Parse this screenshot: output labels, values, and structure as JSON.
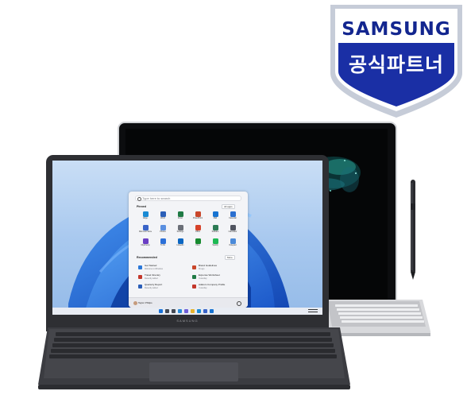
{
  "badge": {
    "brand": "SAMSUNG",
    "tag": "공식파트너",
    "colors": {
      "shield_outer": "#c2c9d6",
      "shield_inner": "#ffffff",
      "banner": "#1a2fa5",
      "brand_text": "#13268f"
    }
  },
  "laptop": {
    "bezel_brand": "SAMSUNG",
    "start_menu": {
      "search_placeholder": "Type here to search",
      "pinned_heading": "Pinned",
      "all_apps_label": "All apps",
      "pinned_apps": [
        {
          "label": "Edge",
          "color": "#1a8ad4"
        },
        {
          "label": "Word",
          "color": "#2b5fb8"
        },
        {
          "label": "Excel",
          "color": "#1f7a45"
        },
        {
          "label": "PowerPoint",
          "color": "#c9472b"
        },
        {
          "label": "Mail",
          "color": "#1773d1"
        },
        {
          "label": "Calendar",
          "color": "#2a6fd0"
        },
        {
          "label": "Microsoft Store",
          "color": "#3a64c8"
        },
        {
          "label": "Photos",
          "color": "#5a8fe0"
        },
        {
          "label": "Settings",
          "color": "#6b6f78"
        },
        {
          "label": "Office",
          "color": "#d6432b"
        },
        {
          "label": "Solitaire",
          "color": "#2c7b55"
        },
        {
          "label": "Calculator",
          "color": "#505460"
        },
        {
          "label": "Clipchamp",
          "color": "#6b3fc4"
        },
        {
          "label": "To Do",
          "color": "#2b6fd8"
        },
        {
          "label": "LinkedIn",
          "color": "#0a66c2"
        },
        {
          "label": "Xbox",
          "color": "#178a2f"
        },
        {
          "label": "Spotify",
          "color": "#1db954"
        },
        {
          "label": "Notepad",
          "color": "#4b8ad9"
        }
      ],
      "recommended_heading": "Recommended",
      "more_label": "More",
      "recommended_items": [
        {
          "title": "Get Started",
          "subtitle": "Welcome to Windows",
          "color": "#2b78d8"
        },
        {
          "title": "Travel Itinerary",
          "subtitle": "Recently added",
          "color": "#c3372b"
        },
        {
          "title": "Quarterly Report",
          "subtitle": "Recently added",
          "color": "#2b5fb8"
        },
        {
          "title": "Brand Guidelines",
          "subtitle": "3h ago",
          "color": "#c9472b"
        },
        {
          "title": "Expense Worksheet",
          "subtitle": "Yesterday",
          "color": "#1f7a45"
        },
        {
          "title": "Adatum Company Profile",
          "subtitle": "Yesterday",
          "color": "#c3372b"
        }
      ],
      "user_name": "Taylor Philips"
    },
    "taskbar": {
      "icons": [
        {
          "name": "start",
          "color": "#1a73d9"
        },
        {
          "name": "search",
          "color": "#444a55"
        },
        {
          "name": "task-view",
          "color": "#444a55"
        },
        {
          "name": "widgets",
          "color": "#2a8ad8"
        },
        {
          "name": "chat",
          "color": "#6f5fd8"
        },
        {
          "name": "explorer",
          "color": "#e6b32e"
        },
        {
          "name": "edge",
          "color": "#1a8ad4"
        },
        {
          "name": "store",
          "color": "#3a64c8"
        },
        {
          "name": "mail",
          "color": "#1773d1"
        }
      ]
    }
  }
}
